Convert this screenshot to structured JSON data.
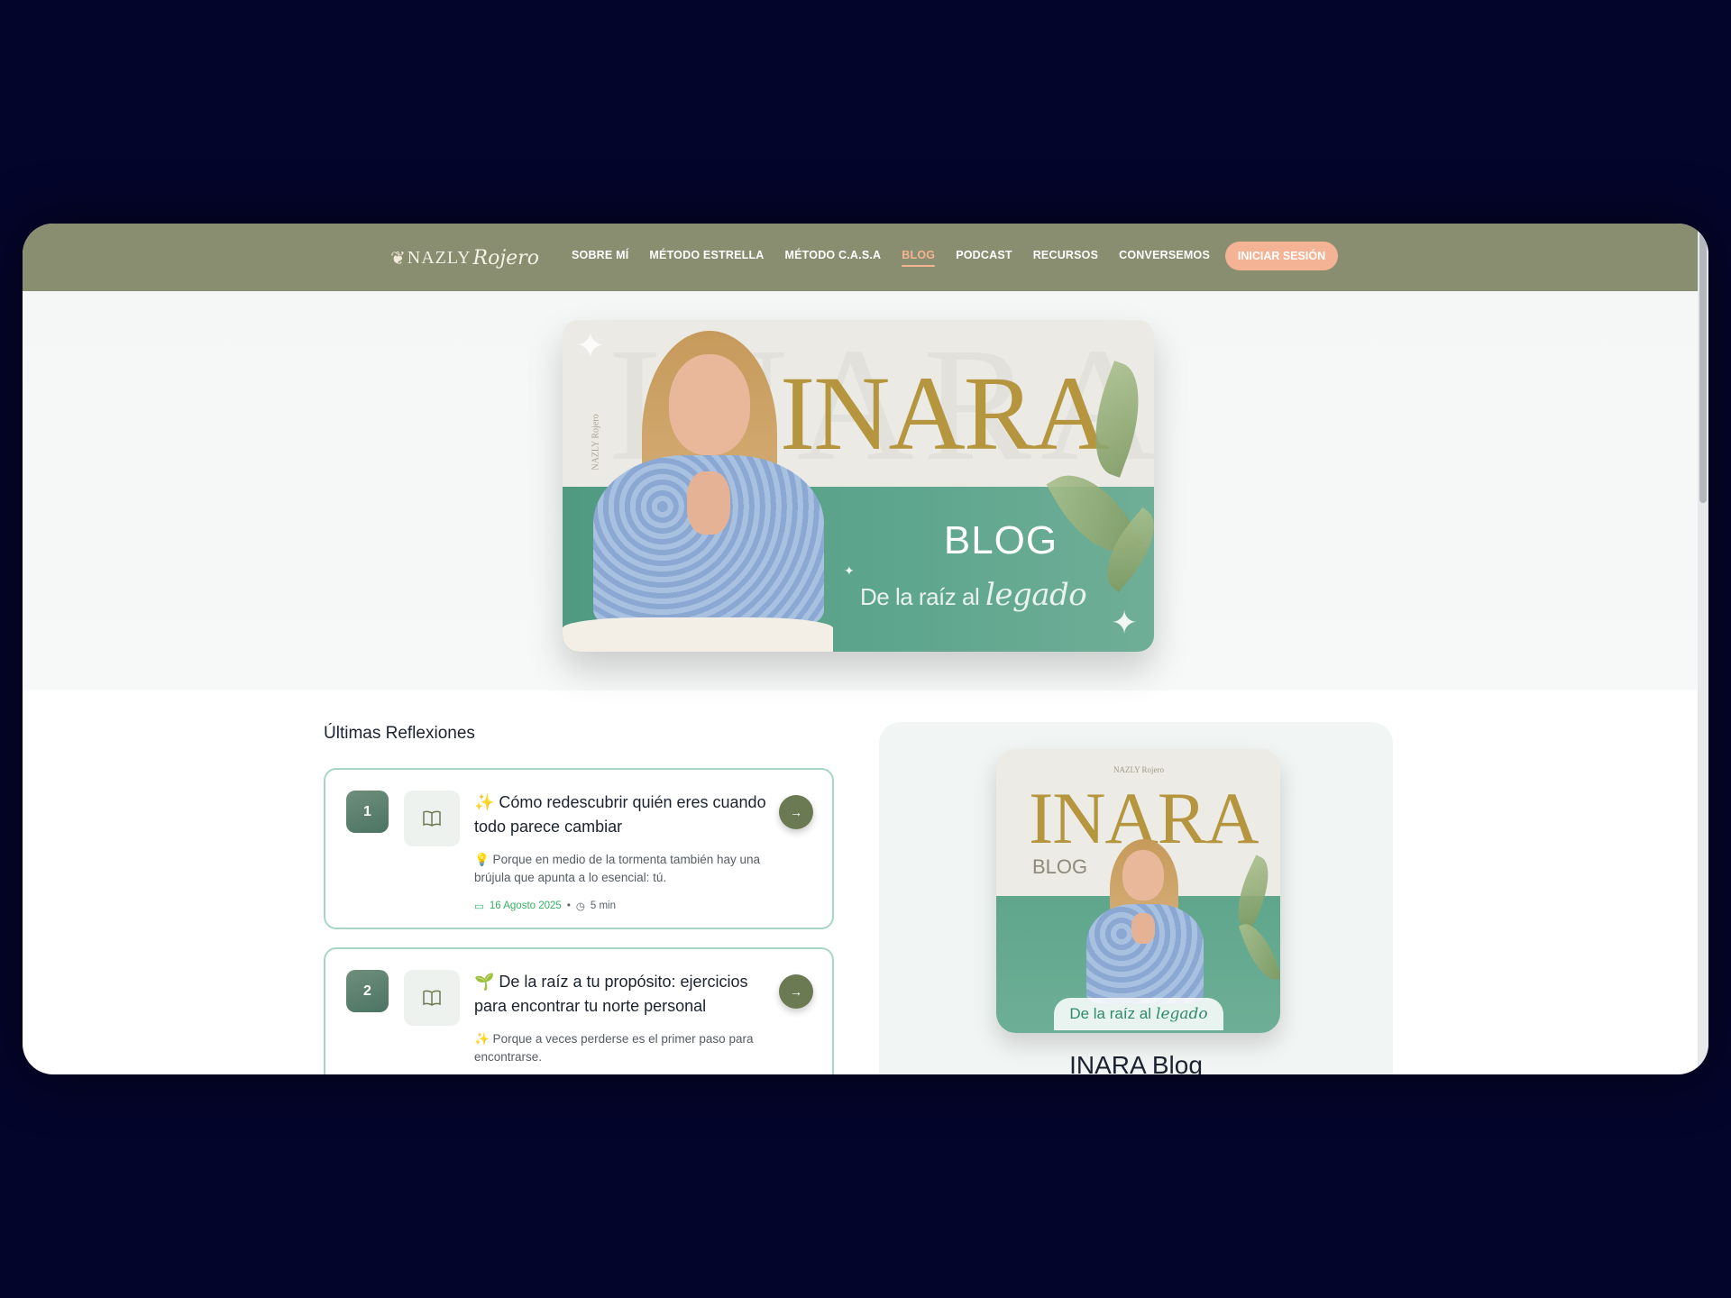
{
  "brand": {
    "logo_leaf": "❦",
    "logo_main": "NAZLY",
    "logo_script": "Rojero"
  },
  "nav": {
    "items": [
      "SOBRE MÍ",
      "MÉTODO ESTRELLA",
      "MÉTODO C.A.S.A",
      "BLOG",
      "PODCAST",
      "RECURSOS",
      "CONVERSEMOS"
    ],
    "active": "BLOG",
    "login_label": "INICIAR SESIÓN"
  },
  "hero": {
    "title": "INARA",
    "subtitle": "BLOG",
    "tagline": "De la raíz al",
    "tagline_script": "legado",
    "side_logo": "NAZLY Rojero"
  },
  "main": {
    "section_title": "Últimas Reflexiones",
    "posts": [
      {
        "number": "1",
        "title": "✨ Cómo redescubrir quién eres cuando todo parece cambiar",
        "description": "💡 Porque en medio de la tormenta también hay una brújula que apunta a lo esencial: tú.",
        "date": "16 Agosto 2025",
        "read_time": "5 min"
      },
      {
        "number": "2",
        "title": "🌱 De la raíz a tu propósito: ejercicios para encontrar tu norte personal",
        "description": "✨ Porque a veces perderse es el primer paso para encontrarse."
      }
    ]
  },
  "sidebar": {
    "cover_title": "INARA",
    "cover_sub": "BLOG",
    "cover_logo": "NAZLY Rojero",
    "cover_tagline": "De la raíz al",
    "cover_tagline_script": "legado",
    "title": "INARA Blog"
  },
  "colors": {
    "header": "#8a8e70",
    "accent": "#f3b394",
    "gold": "#b5963f",
    "green": "#5fa68e",
    "date_green": "#35b063"
  }
}
